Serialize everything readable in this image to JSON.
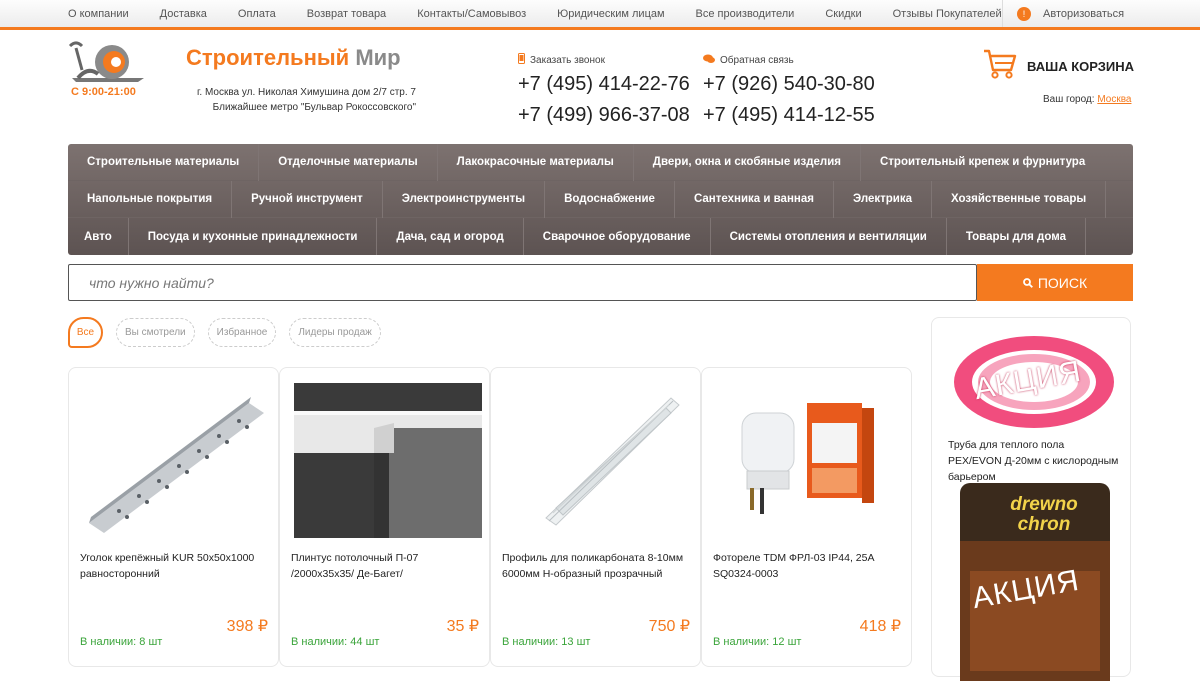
{
  "topnav": {
    "links": [
      "О компании",
      "Доставка",
      "Оплата",
      "Возврат товара",
      "Контакты/Самовывоз",
      "Юридическим лицам",
      "Все производители",
      "Скидки",
      "Отзывы Покупателей"
    ],
    "auth_badge": "!",
    "auth_label": "Авторизоваться"
  },
  "header": {
    "hours": "С 9:00-21:00",
    "brand_part1": "Строительный",
    "brand_part2": "Мир",
    "address_line1": "г. Москва ул. Николая Химушина дом 2/7 стр. 7",
    "address_line2": "Ближайшее метро \"Бульвар Рокоссовского\"",
    "callback_label": "Заказать звонок",
    "callback_phones": [
      "+7 (495) 414-22-76",
      "+7 (499) 966-37-08"
    ],
    "feedback_label": "Обратная связь",
    "feedback_phones": [
      "+7 (926) 540-30-80",
      "+7 (495) 414-12-55"
    ],
    "cart_label": "ВАША КОРЗИНА",
    "city_label": "Ваш город:",
    "city_value": "Москва"
  },
  "menu": {
    "row1": [
      "Строительные материалы",
      "Отделочные материалы",
      "Лакокрасочные материалы",
      "Двери, окна и скобяные изделия",
      "Строительный крепеж и фурнитура"
    ],
    "row2": [
      "Напольные покрытия",
      "Ручной инструмент",
      "Электроинструменты",
      "Водоснабжение",
      "Сантехника и ванная",
      "Электрика",
      "Хозяйственные товары"
    ],
    "row3": [
      "Авто",
      "Посуда и кухонные принадлежности",
      "Дача, сад и огород",
      "Сварочное оборудование",
      "Системы отопления и вентиляции",
      "Товары для дома"
    ]
  },
  "search": {
    "placeholder": "что нужно найти?",
    "button_label": "ПОИСК"
  },
  "filters": [
    "Все",
    "Вы смотрели",
    "Избранное",
    "Лидеры продаж"
  ],
  "products": [
    {
      "name": "Уголок крепёжный KUR 50х50х1000 равносторонний",
      "price": "398 ₽",
      "stock": "В наличии: 8 шт"
    },
    {
      "name": "Плинтус потолочный П-07 /2000х35х35/ Де-Багет/",
      "price": "35 ₽",
      "stock": "В наличии: 44 шт"
    },
    {
      "name": "Профиль для поликарбоната 8-10мм 6000мм Н-образный прозрачный",
      "price": "750 ₽",
      "stock": "В наличии: 13 шт"
    },
    {
      "name": "Фотореле TDM ФРЛ-03 IP44, 25А SQ0324-0003",
      "price": "418 ₽",
      "stock": "В наличии: 12 шт"
    }
  ],
  "promos": [
    {
      "badge": "АКЦИЯ",
      "title": "Труба для теплого пола PEX/EVON Д-20мм с кислородным барьером"
    },
    {
      "badge": "АКЦИЯ",
      "brand_text": "drewno chron"
    }
  ],
  "colors": {
    "accent": "#f47a1f",
    "menu_bg": "#6b605f",
    "stock_green": "#3aa43a"
  }
}
